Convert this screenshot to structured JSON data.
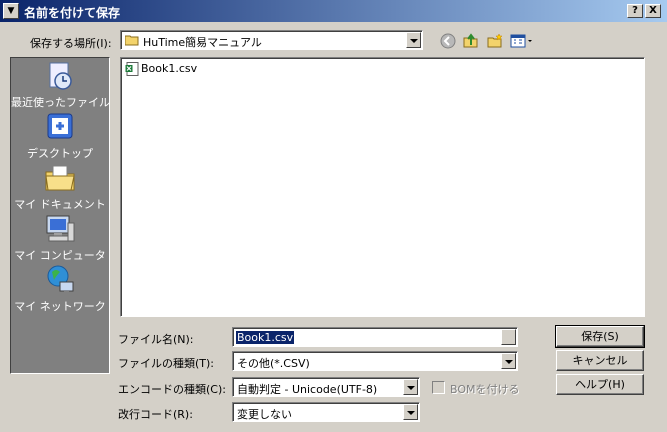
{
  "window": {
    "title": "名前を付けて保存",
    "help_button": "?",
    "close_button": "X"
  },
  "location": {
    "label": "保存する場所(I):",
    "value": "HuTime簡易マニュアル"
  },
  "places": [
    {
      "label": "最近使ったファイル",
      "icon": "recent-files-icon"
    },
    {
      "label": "デスクトップ",
      "icon": "desktop-icon"
    },
    {
      "label": "マイ ドキュメント",
      "icon": "my-documents-icon"
    },
    {
      "label": "マイ コンピュータ",
      "icon": "my-computer-icon"
    },
    {
      "label": "マイ ネットワーク",
      "icon": "my-network-icon"
    }
  ],
  "files": [
    {
      "name": "Book1.csv",
      "icon": "csv-file-icon"
    }
  ],
  "form": {
    "filename_label": "ファイル名(N):",
    "filename_value": "Book1.csv",
    "filetype_label": "ファイルの種類(T):",
    "filetype_value": "その他(*.CSV)",
    "encoding_label": "エンコードの種類(C):",
    "encoding_value": "自動判定 - Unicode(UTF-8)",
    "bom_label": "BOMを付ける",
    "newline_label": "改行コード(R):",
    "newline_value": "変更しない"
  },
  "buttons": {
    "save": "保存(S)",
    "cancel": "キャンセル",
    "help": "ヘルプ(H)"
  },
  "colors": {
    "titlebar_start": "#0a246a",
    "titlebar_end": "#a6caf0",
    "dialog_bg": "#d4d0c8",
    "places_bg": "#808080",
    "selection": "#0a246a"
  }
}
